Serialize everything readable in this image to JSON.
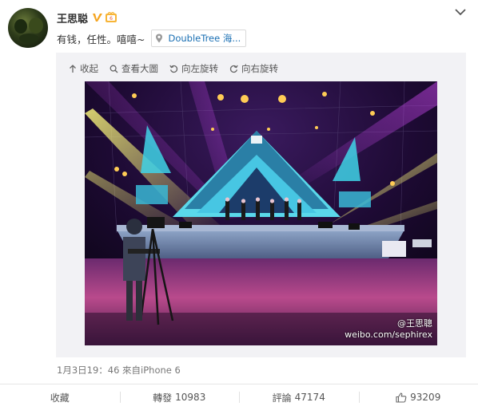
{
  "user": {
    "name": "王思聪"
  },
  "post": {
    "text": "有钱，任性。嘻嘻~",
    "location": "DoubleTree 海..."
  },
  "media_toolbar": {
    "collapse": "收起",
    "view_large": "查看大圖",
    "rotate_left": "向左旋转",
    "rotate_right": "向右旋转"
  },
  "photo": {
    "watermark_user": "@王思聰",
    "watermark_url": "weibo.com/sephirex"
  },
  "meta": {
    "time_source": "1月3日19：46 來自iPhone 6"
  },
  "actions": {
    "favorite_label": "收藏",
    "repost_label": "轉發",
    "repost_count": "10983",
    "comment_label": "評論",
    "comment_count": "47174",
    "like_count": "93209"
  },
  "colors": {
    "link": "#1a6fb3",
    "vip": "#f5a623",
    "media_bg": "#f2f2f5"
  }
}
